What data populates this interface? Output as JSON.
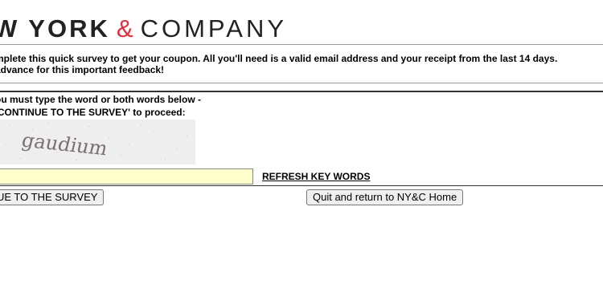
{
  "logo": {
    "left_text": "W YORK",
    "ampersand": "&",
    "right_text": "COMPANY",
    "ampersand_color": "#e0303c"
  },
  "intro": {
    "line1": "mplete this quick survey to get your coupon. All you'll need is a valid email address and your receipt from the last 14 days.",
    "line2": "advance for this important feedback!"
  },
  "instructions": {
    "line1": "ou must type the word or both words below -",
    "line2": "'CONTINUE TO THE SURVEY' to proceed:"
  },
  "captcha": {
    "word": "gaudium"
  },
  "keyword_input": {
    "value": "",
    "background_color": "#ffffcc"
  },
  "refresh_link": {
    "label": "REFRESH KEY WORDS"
  },
  "buttons": {
    "continue_label": "UE TO THE SURVEY",
    "quit_label": "Quit and return to NY&C Home"
  }
}
